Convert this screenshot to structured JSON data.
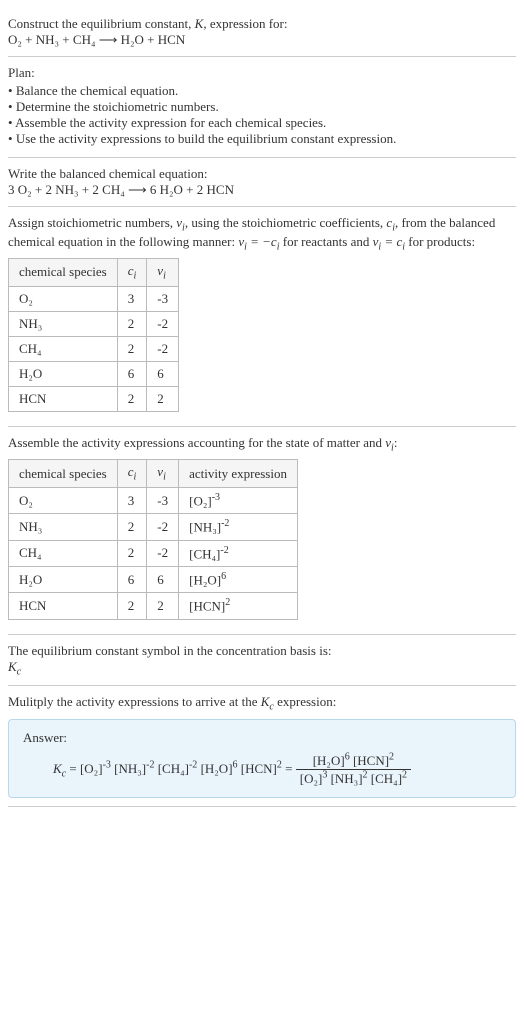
{
  "intro": {
    "line1": "Construct the equilibrium constant, K, expression for:",
    "eq": "O₂ + NH₃ + CH₄  ⟶  H₂O + HCN"
  },
  "plan": {
    "title": "Plan:",
    "items": [
      "Balance the chemical equation.",
      "Determine the stoichiometric numbers.",
      "Assemble the activity expression for each chemical species.",
      "Use the activity expressions to build the equilibrium constant expression."
    ]
  },
  "balanced": {
    "title": "Write the balanced chemical equation:",
    "eq": "3 O₂ + 2 NH₃ + 2 CH₄  ⟶  6 H₂O + 2 HCN"
  },
  "stoich": {
    "desc_a": "Assign stoichiometric numbers, ",
    "desc_b": ", using the stoichiometric coefficients, ",
    "desc_c": ", from the balanced chemical equation in the following manner: ",
    "desc_d": " for reactants and ",
    "desc_e": " for products:",
    "headers": {
      "species": "chemical species",
      "ci": "cᵢ",
      "vi": "νᵢ"
    },
    "rows": [
      {
        "sp": "O₂",
        "c": "3",
        "v": "-3"
      },
      {
        "sp": "NH₃",
        "c": "2",
        "v": "-2"
      },
      {
        "sp": "CH₄",
        "c": "2",
        "v": "-2"
      },
      {
        "sp": "H₂O",
        "c": "6",
        "v": "6"
      },
      {
        "sp": "HCN",
        "c": "2",
        "v": "2"
      }
    ]
  },
  "activity": {
    "desc_a": "Assemble the activity expressions accounting for the state of matter and ",
    "desc_b": ":",
    "headers": {
      "species": "chemical species",
      "ci": "cᵢ",
      "vi": "νᵢ",
      "act": "activity expression"
    },
    "rows": [
      {
        "sp": "O₂",
        "c": "3",
        "v": "-3",
        "base": "[O₂]",
        "exp": "-3"
      },
      {
        "sp": "NH₃",
        "c": "2",
        "v": "-2",
        "base": "[NH₃]",
        "exp": "-2"
      },
      {
        "sp": "CH₄",
        "c": "2",
        "v": "-2",
        "base": "[CH₄]",
        "exp": "-2"
      },
      {
        "sp": "H₂O",
        "c": "6",
        "v": "6",
        "base": "[H₂O]",
        "exp": "6"
      },
      {
        "sp": "HCN",
        "c": "2",
        "v": "2",
        "base": "[HCN]",
        "exp": "2"
      }
    ]
  },
  "symbol": {
    "line": "The equilibrium constant symbol in the concentration basis is:",
    "kc": "K",
    "kc_sub": "c"
  },
  "multiply": {
    "line_a": "Mulitply the activity expressions to arrive at the ",
    "line_b": " expression:"
  },
  "answer": {
    "label": "Answer:",
    "lhs": "Kc = ",
    "terms": [
      {
        "base": "[O₂]",
        "exp": "-3"
      },
      {
        "base": "[NH₃]",
        "exp": "-2"
      },
      {
        "base": "[CH₄]",
        "exp": "-2"
      },
      {
        "base": "[H₂O]",
        "exp": "6"
      },
      {
        "base": "[HCN]",
        "exp": "2"
      }
    ],
    "eq": " = ",
    "num": [
      {
        "base": "[H₂O]",
        "exp": "6"
      },
      {
        "base": "[HCN]",
        "exp": "2"
      }
    ],
    "den": [
      {
        "base": "[O₂]",
        "exp": "3"
      },
      {
        "base": "[NH₃]",
        "exp": "2"
      },
      {
        "base": "[CH₄]",
        "exp": "2"
      }
    ]
  }
}
